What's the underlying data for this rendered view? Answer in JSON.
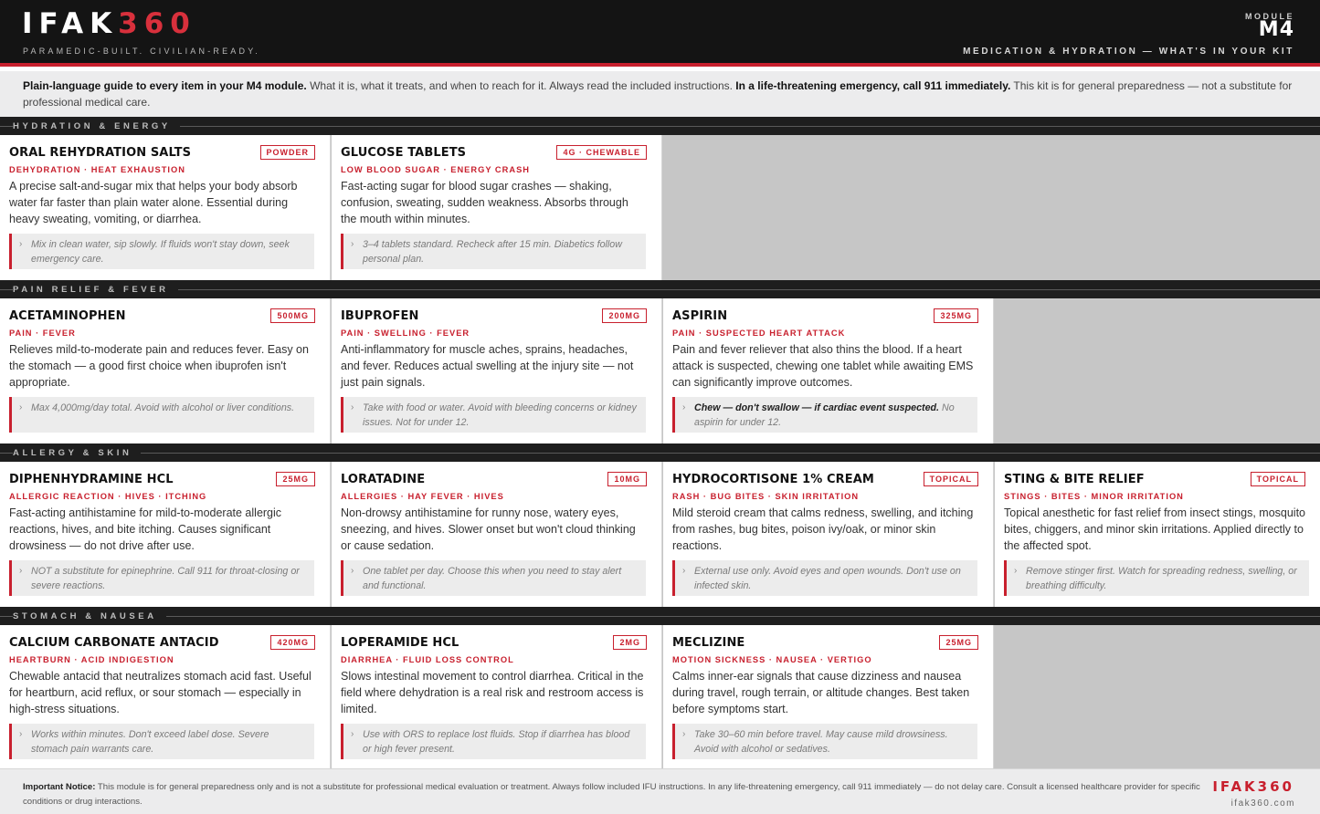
{
  "header": {
    "logo_main": "IFAK",
    "logo_accent": "360",
    "tagline": "PARAMEDIC-BUILT. CIVILIAN-READY.",
    "module_label": "MODULE",
    "module_code": "M4",
    "module_subtitle": "MEDICATION & HYDRATION — WHAT'S IN YOUR KIT"
  },
  "intro": {
    "lead_bold": "Plain-language guide to every item in your M4 module.",
    "lead_text": " What it is, what it treats, and when to reach for it. Always read the included instructions. ",
    "emergency_bold": "In a life-threatening emergency, call 911 immediately.",
    "tail_text": " This kit is for general preparedness — not a substitute for professional medical care."
  },
  "sections": [
    {
      "label": "HYDRATION & ENERGY",
      "cards": [
        {
          "title": "ORAL REHYDRATION SALTS",
          "badge": "POWDER",
          "subtitle": "DEHYDRATION · HEAT EXHAUSTION",
          "desc": "A precise salt-and-sugar mix that helps your body absorb water far faster than plain water alone. Essential during heavy sweating, vomiting, or diarrhea.",
          "note_bold": "",
          "note": "Mix in clean water, sip slowly. If fluids won't stay down, seek emergency care."
        },
        {
          "title": "GLUCOSE TABLETS",
          "badge": "4G · CHEWABLE",
          "subtitle": "LOW BLOOD SUGAR · ENERGY CRASH",
          "desc": "Fast-acting sugar for blood sugar crashes — shaking, confusion, sweating, sudden weakness. Absorbs through the mouth within minutes.",
          "note_bold": "",
          "note": "3–4 tablets standard. Recheck after 15 min. Diabetics follow personal plan."
        }
      ]
    },
    {
      "label": "PAIN RELIEF & FEVER",
      "cards": [
        {
          "title": "ACETAMINOPHEN",
          "badge": "500MG",
          "subtitle": "PAIN · FEVER",
          "desc": "Relieves mild-to-moderate pain and reduces fever. Easy on the stomach — a good first choice when ibuprofen isn't appropriate.",
          "note_bold": "",
          "note": "Max 4,000mg/day total. Avoid with alcohol or liver conditions."
        },
        {
          "title": "IBUPROFEN",
          "badge": "200MG",
          "subtitle": "PAIN · SWELLING · FEVER",
          "desc": "Anti-inflammatory for muscle aches, sprains, headaches, and fever. Reduces actual swelling at the injury site — not just pain signals.",
          "note_bold": "",
          "note": "Take with food or water. Avoid with bleeding concerns or kidney issues. Not for under 12."
        },
        {
          "title": "ASPIRIN",
          "badge": "325MG",
          "subtitle": "PAIN · SUSPECTED HEART ATTACK",
          "desc": "Pain and fever reliever that also thins the blood. If a heart attack is suspected, chewing one tablet while awaiting EMS can significantly improve outcomes.",
          "note_bold": "Chew — don't swallow — if cardiac event suspected.",
          "note": " No aspirin for under 12."
        }
      ]
    },
    {
      "label": "ALLERGY & SKIN",
      "cards": [
        {
          "title": "DIPHENHYDRAMINE HCL",
          "badge": "25MG",
          "subtitle": "ALLERGIC REACTION · HIVES · ITCHING",
          "desc": "Fast-acting antihistamine for mild-to-moderate allergic reactions, hives, and bite itching. Causes significant drowsiness — do not drive after use.",
          "note_bold": "",
          "note": "NOT a substitute for epinephrine. Call 911 for throat-closing or severe reactions."
        },
        {
          "title": "LORATADINE",
          "badge": "10MG",
          "subtitle": "ALLERGIES · HAY FEVER · HIVES",
          "desc": "Non-drowsy antihistamine for runny nose, watery eyes, sneezing, and hives. Slower onset but won't cloud thinking or cause sedation.",
          "note_bold": "",
          "note": "One tablet per day. Choose this when you need to stay alert and functional."
        },
        {
          "title": "HYDROCORTISONE 1% CREAM",
          "badge": "TOPICAL",
          "subtitle": "RASH · BUG BITES · SKIN IRRITATION",
          "desc": "Mild steroid cream that calms redness, swelling, and itching from rashes, bug bites, poison ivy/oak, or minor skin reactions.",
          "note_bold": "",
          "note": "External use only. Avoid eyes and open wounds. Don't use on infected skin."
        },
        {
          "title": "STING & BITE RELIEF",
          "badge": "TOPICAL",
          "subtitle": "STINGS · BITES · MINOR IRRITATION",
          "desc": "Topical anesthetic for fast relief from insect stings, mosquito bites, chiggers, and minor skin irritations. Applied directly to the affected spot.",
          "note_bold": "",
          "note": "Remove stinger first. Watch for spreading redness, swelling, or breathing difficulty."
        }
      ]
    },
    {
      "label": "STOMACH & NAUSEA",
      "cards": [
        {
          "title": "CALCIUM CARBONATE ANTACID",
          "badge": "420MG",
          "subtitle": "HEARTBURN · ACID INDIGESTION",
          "desc": "Chewable antacid that neutralizes stomach acid fast. Useful for heartburn, acid reflux, or sour stomach — especially in high-stress situations.",
          "note_bold": "",
          "note": "Works within minutes. Don't exceed label dose. Severe stomach pain warrants care."
        },
        {
          "title": "LOPERAMIDE HCL",
          "badge": "2MG",
          "subtitle": "DIARRHEA · FLUID LOSS CONTROL",
          "desc": "Slows intestinal movement to control diarrhea. Critical in the field where dehydration is a real risk and restroom access is limited.",
          "note_bold": "",
          "note": "Use with ORS to replace lost fluids. Stop if diarrhea has blood or high fever present."
        },
        {
          "title": "MECLIZINE",
          "badge": "25MG",
          "subtitle": "MOTION SICKNESS · NAUSEA · VERTIGO",
          "desc": "Calms inner-ear signals that cause dizziness and nausea during travel, rough terrain, or altitude changes. Best taken before symptoms start.",
          "note_bold": "",
          "note": "Take 30–60 min before travel. May cause mild drowsiness. Avoid with alcohol or sedatives."
        }
      ]
    }
  ],
  "footer": {
    "notice_bold": "Important Notice:",
    "notice_text": " This module is for general preparedness only and is not a substitute for professional medical evaluation or treatment. Always follow included IFU instructions. In any life-threatening emergency, call 911 immediately — do not delay care. Consult a licensed healthcare provider for specific conditions or drug interactions.",
    "brand": "IFAK360",
    "url": "ifak360.com"
  }
}
